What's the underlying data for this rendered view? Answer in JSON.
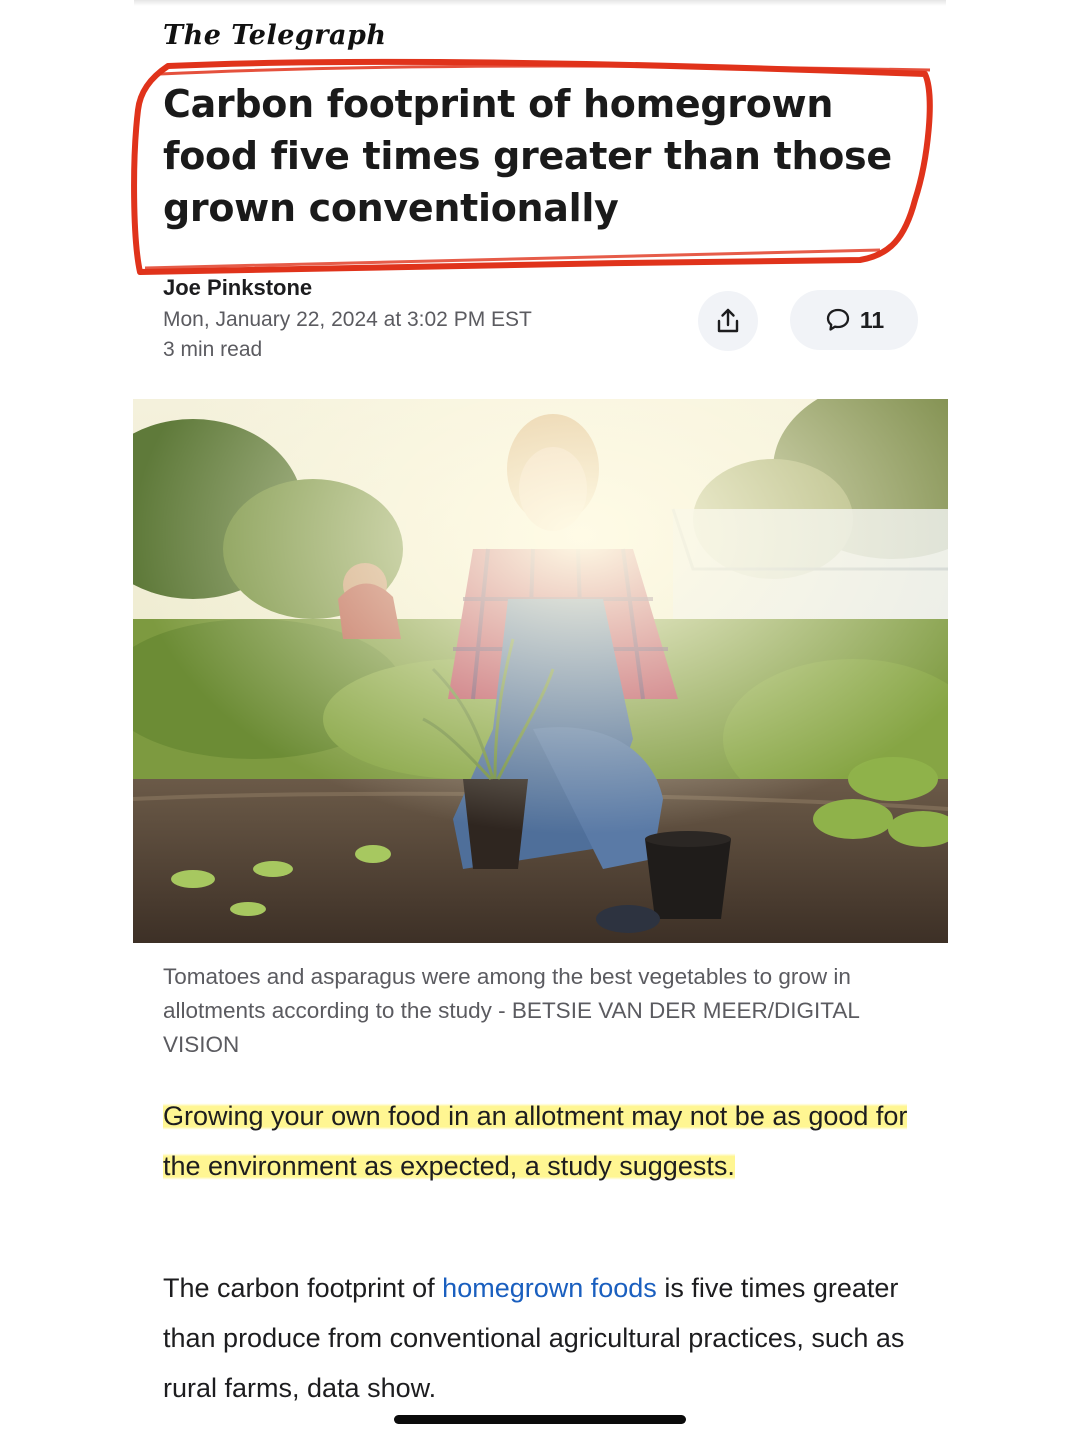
{
  "publisher": "The Telegraph",
  "headline": "Carbon footprint of homegrown food five times greater than those grown conventionally",
  "byline": {
    "author": "Joe Pinkstone",
    "date": "Mon, January 22, 2024 at 3:02 PM EST",
    "read_time": "3 min read"
  },
  "actions": {
    "share_icon": "share-icon",
    "comment_icon": "comment-bubble-icon",
    "comment_count": "11"
  },
  "photo": {
    "caption": "Tomatoes and asparagus were among the best vegetables to grow in allotments according to the study - BETSIE VAN DER MEER/DIGITAL VISION"
  },
  "body": {
    "paragraph1_highlighted": "Growing your own food in an allotment may not be as good for the environment as expected, a study suggests.",
    "paragraph2_before": "The carbon footprint of ",
    "paragraph2_link": "homegrown foods",
    "paragraph2_after": " is five times greater than produce from conventional agricultural practices, such as rural farms, data show."
  },
  "colors": {
    "annotation_red": "#e0331b",
    "highlight_yellow": "#fff58c",
    "link_blue": "#1a5fbf",
    "button_bg": "#f1f3f7"
  }
}
